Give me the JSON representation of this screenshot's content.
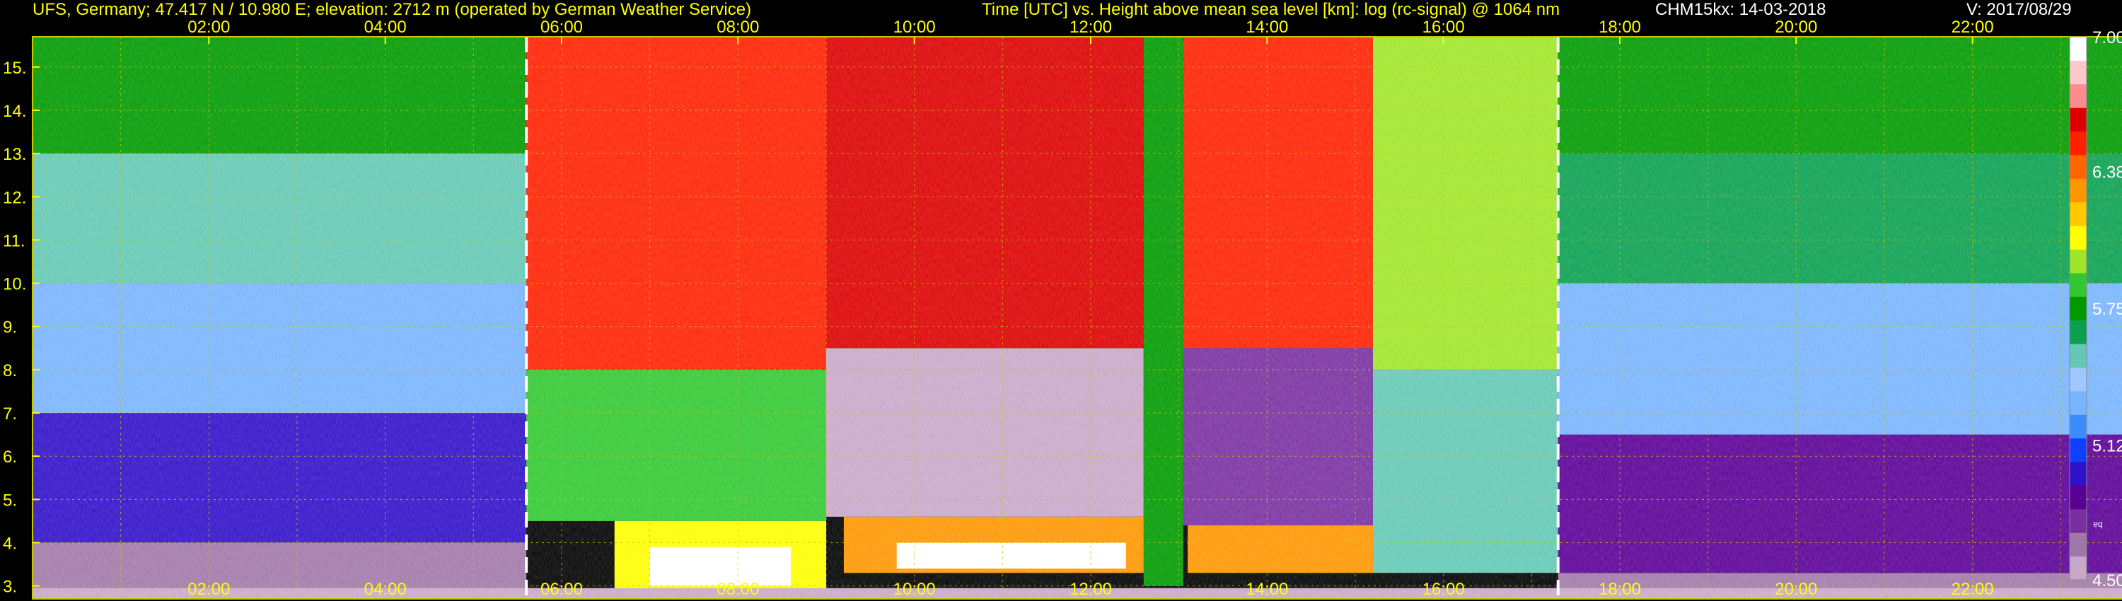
{
  "header": {
    "site": "UFS, Germany; 47.417 N / 10.980 E; elevation: 2712 m  (operated by German Weather Service)",
    "title": "Time [UTC] vs. Height above mean sea level [km]: log (rc-signal) @ 1064 nm",
    "instrument": "CHM15kx: 14-03-2018",
    "version": "V: 2017/08/29"
  },
  "colors": {
    "axis_text": "#ffff00",
    "grid": "#c8c800",
    "marker_line": "#ffffff",
    "background": "#000000"
  },
  "chart_data": {
    "type": "heatmap",
    "title": "Time [UTC] vs. Height above mean sea level [km]: log (rc-signal) @ 1064 nm",
    "xlabel": "",
    "ylabel": "",
    "x_unit": "hours UTC",
    "xlim": [
      0,
      24
    ],
    "ylim": [
      2.7,
      15.7
    ],
    "x_ticks": [
      2,
      4,
      6,
      8,
      10,
      12,
      14,
      16,
      18,
      20,
      22
    ],
    "x_tick_labels": [
      "02:00",
      "04:00",
      "06:00",
      "08:00",
      "10:00",
      "12:00",
      "14:00",
      "16:00",
      "18:00",
      "20:00",
      "22:00"
    ],
    "y_ticks": [
      3,
      4,
      5,
      6,
      7,
      8,
      9,
      10,
      11,
      12,
      13,
      14,
      15
    ],
    "y_tick_labels": [
      "3.",
      "4.",
      "5.",
      "6.",
      "7.",
      "8.",
      "9.",
      "10.",
      "11.",
      "12.",
      "13.",
      "14.",
      "15."
    ],
    "grid": true,
    "vertical_markers_hours": [
      5.6,
      17.3
    ],
    "colorbar": {
      "range": [
        4.5,
        7.0
      ],
      "tick_values": [
        4.5,
        5.12,
        5.75,
        6.38,
        7.0
      ],
      "tick_labels": [
        "4.50",
        "5.12",
        "5.75",
        "6.38",
        "7.00"
      ],
      "small_label": "eq",
      "colors": [
        "#c8a8c8",
        "#a078a8",
        "#7830a0",
        "#5a0096",
        "#3010c8",
        "#1040ff",
        "#3c8cff",
        "#78b4ff",
        "#a0c8ff",
        "#64c8b4",
        "#0aa050",
        "#009a00",
        "#32c832",
        "#a0e628",
        "#ffff00",
        "#ffc800",
        "#ff9600",
        "#ff6400",
        "#ff2000",
        "#dc0000",
        "#ff8c8c",
        "#ffc8c8",
        "#ffffff"
      ]
    },
    "regions": [
      {
        "t0": 0.0,
        "t1": 5.6,
        "h0": 2.7,
        "h1": 4.0,
        "value": 4.65
      },
      {
        "t0": 0.0,
        "t1": 5.6,
        "h0": 4.0,
        "h1": 7.0,
        "value": 4.95
      },
      {
        "t0": 0.0,
        "t1": 5.6,
        "h0": 7.0,
        "h1": 10.0,
        "value": 5.3
      },
      {
        "t0": 0.0,
        "t1": 5.6,
        "h0": 10.0,
        "h1": 13.0,
        "value": 5.55
      },
      {
        "t0": 0.0,
        "t1": 5.6,
        "h0": 13.0,
        "h1": 15.7,
        "value": 5.75
      },
      {
        "t0": 5.6,
        "t1": 9.0,
        "h0": 4.5,
        "h1": 8.0,
        "value": 5.9
      },
      {
        "t0": 5.6,
        "t1": 9.0,
        "h0": 8.0,
        "h1": 15.7,
        "value": 6.5
      },
      {
        "t0": 9.0,
        "t1": 12.6,
        "h0": 4.6,
        "h1": 8.5,
        "value": 4.55
      },
      {
        "t0": 9.0,
        "t1": 12.6,
        "h0": 8.5,
        "h1": 15.7,
        "value": 6.7
      },
      {
        "t0": 12.6,
        "t1": 13.05,
        "h0": 3.0,
        "h1": 15.7,
        "value": 5.8
      },
      {
        "t0": 13.05,
        "t1": 15.2,
        "h0": 4.4,
        "h1": 8.5,
        "value": 4.7
      },
      {
        "t0": 13.05,
        "t1": 15.2,
        "h0": 8.5,
        "h1": 15.7,
        "value": 6.6
      },
      {
        "t0": 15.2,
        "t1": 17.3,
        "h0": 3.3,
        "h1": 8.0,
        "value": 5.5
      },
      {
        "t0": 15.2,
        "t1": 17.3,
        "h0": 8.0,
        "h1": 15.7,
        "value": 6.0
      },
      {
        "t0": 17.3,
        "t1": 24.0,
        "h0": 2.7,
        "h1": 3.3,
        "value": 4.6
      },
      {
        "t0": 17.3,
        "t1": 24.0,
        "h0": 3.3,
        "h1": 6.5,
        "value": 4.85
      },
      {
        "t0": 17.3,
        "t1": 24.0,
        "h0": 6.5,
        "h1": 10.0,
        "value": 5.3
      },
      {
        "t0": 17.3,
        "t1": 24.0,
        "h0": 10.0,
        "h1": 13.0,
        "value": 5.6
      },
      {
        "t0": 17.3,
        "t1": 24.0,
        "h0": 13.0,
        "h1": 15.7,
        "value": 5.8
      },
      {
        "t0": 6.6,
        "t1": 9.0,
        "h0": 2.9,
        "h1": 4.5,
        "value": 6.1
      },
      {
        "t0": 9.2,
        "t1": 12.6,
        "h0": 3.3,
        "h1": 4.6,
        "value": 6.35
      },
      {
        "t0": 13.1,
        "t1": 15.2,
        "h0": 3.3,
        "h1": 4.4,
        "value": 6.3
      },
      {
        "t0": 7.0,
        "t1": 8.6,
        "h0": 3.0,
        "h1": 3.9,
        "value": 7.0
      },
      {
        "t0": 9.8,
        "t1": 12.4,
        "h0": 3.4,
        "h1": 4.0,
        "value": 7.0
      },
      {
        "t0": 0.0,
        "t1": 24.0,
        "h0": 2.7,
        "h1": 2.95,
        "value": 4.5
      }
    ]
  }
}
